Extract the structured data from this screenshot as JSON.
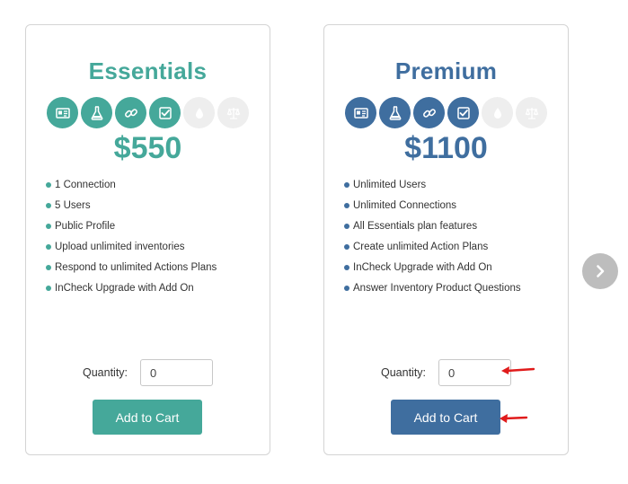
{
  "colors": {
    "essentials_accent": "#45a89a",
    "premium_accent": "#3f6e9f",
    "inactive_icon_bg": "#eeeeee",
    "annotation_arrow": "#e01b1b"
  },
  "plans": [
    {
      "title": "Essentials",
      "price": "$550",
      "icons": [
        {
          "name": "id-card-icon",
          "active": true
        },
        {
          "name": "flask-icon",
          "active": true
        },
        {
          "name": "link-icon",
          "active": true
        },
        {
          "name": "checkbox-icon",
          "active": true
        },
        {
          "name": "drop-icon",
          "active": false
        },
        {
          "name": "scale-icon",
          "active": false
        }
      ],
      "features": [
        "1 Connection",
        "5 Users",
        "Public Profile",
        "Upload unlimited inventories",
        "Respond to unlimited Actions Plans",
        "InCheck Upgrade with Add On"
      ],
      "quantity_label": "Quantity:",
      "quantity_value": "0",
      "button_label": "Add to Cart"
    },
    {
      "title": "Premium",
      "price": "$1100",
      "icons": [
        {
          "name": "id-card-icon",
          "active": true
        },
        {
          "name": "flask-icon",
          "active": true
        },
        {
          "name": "link-icon",
          "active": true
        },
        {
          "name": "checkbox-icon",
          "active": true
        },
        {
          "name": "drop-icon",
          "active": false
        },
        {
          "name": "scale-icon",
          "active": false
        }
      ],
      "features": [
        "Unlimited Users",
        "Unlimited Connections",
        "All Essentials plan features",
        "Create unlimited Action Plans",
        "InCheck Upgrade with Add On",
        "Answer Inventory Product Questions"
      ],
      "quantity_label": "Quantity:",
      "quantity_value": "0",
      "button_label": "Add to Cart"
    }
  ],
  "carousel": {
    "next_icon": "chevron-right-icon"
  }
}
